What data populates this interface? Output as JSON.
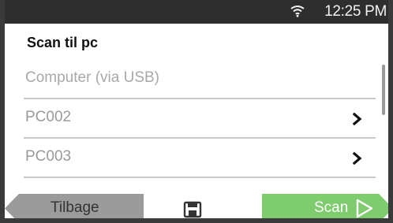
{
  "status_bar": {
    "wifi_icon": "wifi-icon",
    "time": "12:25 PM"
  },
  "screen": {
    "title": "Scan til pc"
  },
  "list": {
    "items": [
      {
        "label": "Computer (via USB)",
        "has_chevron": false
      },
      {
        "label": "PC002",
        "has_chevron": true
      },
      {
        "label": "PC003",
        "has_chevron": true
      }
    ]
  },
  "footer": {
    "back_label": "Tilbage",
    "save_icon": "save-icon",
    "scan_label": "Scan",
    "colors": {
      "back": "#9b9b9b",
      "scan": "#7fcc6e"
    }
  }
}
